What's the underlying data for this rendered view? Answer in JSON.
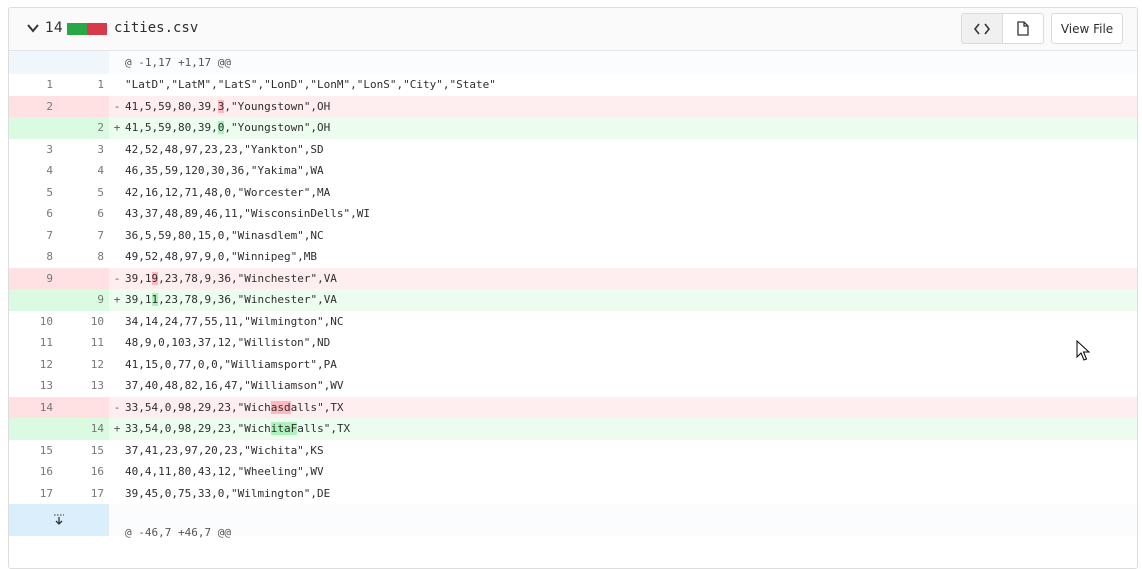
{
  "header": {
    "change_count": "14",
    "filename": "cities.csv",
    "view_file_label": "View File",
    "code_icon": "code-icon",
    "file_icon": "file-icon"
  },
  "colors": {
    "added": "#28a745",
    "removed": "#d73a49"
  },
  "hunks": [
    {
      "text": "@ -1,17 +1,17 @@"
    },
    {
      "text": "@ -46,7 +46,7 @@"
    }
  ],
  "lines": [
    {
      "type": "ctx",
      "old": "1",
      "new": "1",
      "sign": "",
      "segments": [
        {
          "t": "\"LatD\",\"LatM\",\"LatS\",\"LonD\",\"LonM\",\"LonS\",\"City\",\"State\""
        }
      ]
    },
    {
      "type": "del",
      "old": "2",
      "new": "",
      "sign": "-",
      "segments": [
        {
          "t": "41,5,59,80,39,"
        },
        {
          "t": "3",
          "hl": 1
        },
        {
          "t": ",\"Youngstown\",OH"
        }
      ]
    },
    {
      "type": "add",
      "old": "",
      "new": "2",
      "sign": "+",
      "segments": [
        {
          "t": "41,5,59,80,39,"
        },
        {
          "t": "0",
          "hl": 1
        },
        {
          "t": ",\"Youngstown\",OH"
        }
      ]
    },
    {
      "type": "ctx",
      "old": "3",
      "new": "3",
      "sign": "",
      "segments": [
        {
          "t": "42,52,48,97,23,23,\"Yankton\",SD"
        }
      ]
    },
    {
      "type": "ctx",
      "old": "4",
      "new": "4",
      "sign": "",
      "segments": [
        {
          "t": "46,35,59,120,30,36,\"Yakima\",WA"
        }
      ]
    },
    {
      "type": "ctx",
      "old": "5",
      "new": "5",
      "sign": "",
      "segments": [
        {
          "t": "42,16,12,71,48,0,\"Worcester\",MA"
        }
      ]
    },
    {
      "type": "ctx",
      "old": "6",
      "new": "6",
      "sign": "",
      "segments": [
        {
          "t": "43,37,48,89,46,11,\"WisconsinDells\",WI"
        }
      ]
    },
    {
      "type": "ctx",
      "old": "7",
      "new": "7",
      "sign": "",
      "segments": [
        {
          "t": "36,5,59,80,15,0,\"Winasdlem\",NC"
        }
      ]
    },
    {
      "type": "ctx",
      "old": "8",
      "new": "8",
      "sign": "",
      "segments": [
        {
          "t": "49,52,48,97,9,0,\"Winnipeg\",MB"
        }
      ]
    },
    {
      "type": "del",
      "old": "9",
      "new": "",
      "sign": "-",
      "segments": [
        {
          "t": "39,1"
        },
        {
          "t": "9",
          "hl": 1
        },
        {
          "t": ",23,78,9,36,\"Winchester\",VA"
        }
      ]
    },
    {
      "type": "add",
      "old": "",
      "new": "9",
      "sign": "+",
      "segments": [
        {
          "t": "39,1"
        },
        {
          "t": "1",
          "hl": 1
        },
        {
          "t": ",23,78,9,36,\"Winchester\",VA"
        }
      ]
    },
    {
      "type": "ctx",
      "old": "10",
      "new": "10",
      "sign": "",
      "segments": [
        {
          "t": "34,14,24,77,55,11,\"Wilmington\",NC"
        }
      ]
    },
    {
      "type": "ctx",
      "old": "11",
      "new": "11",
      "sign": "",
      "segments": [
        {
          "t": "48,9,0,103,37,12,\"Williston\",ND"
        }
      ]
    },
    {
      "type": "ctx",
      "old": "12",
      "new": "12",
      "sign": "",
      "segments": [
        {
          "t": "41,15,0,77,0,0,\"Williamsport\",PA"
        }
      ]
    },
    {
      "type": "ctx",
      "old": "13",
      "new": "13",
      "sign": "",
      "segments": [
        {
          "t": "37,40,48,82,16,47,\"Williamson\",WV"
        }
      ]
    },
    {
      "type": "del",
      "old": "14",
      "new": "",
      "sign": "-",
      "segments": [
        {
          "t": "33,54,0,98,29,23,\"Wich"
        },
        {
          "t": "asd",
          "hl": 1
        },
        {
          "t": "alls\",TX"
        }
      ]
    },
    {
      "type": "add",
      "old": "",
      "new": "14",
      "sign": "+",
      "segments": [
        {
          "t": "33,54,0,98,29,23,\"Wich"
        },
        {
          "t": "itaF",
          "hl": 1
        },
        {
          "t": "alls\",TX"
        }
      ]
    },
    {
      "type": "ctx",
      "old": "15",
      "new": "15",
      "sign": "",
      "segments": [
        {
          "t": "37,41,23,97,20,23,\"Wichita\",KS"
        }
      ]
    },
    {
      "type": "ctx",
      "old": "16",
      "new": "16",
      "sign": "",
      "segments": [
        {
          "t": "40,4,11,80,43,12,\"Wheeling\",WV"
        }
      ]
    },
    {
      "type": "ctx",
      "old": "17",
      "new": "17",
      "sign": "",
      "segments": [
        {
          "t": "39,45,0,75,33,0,\"Wilmington\",DE"
        }
      ]
    }
  ]
}
